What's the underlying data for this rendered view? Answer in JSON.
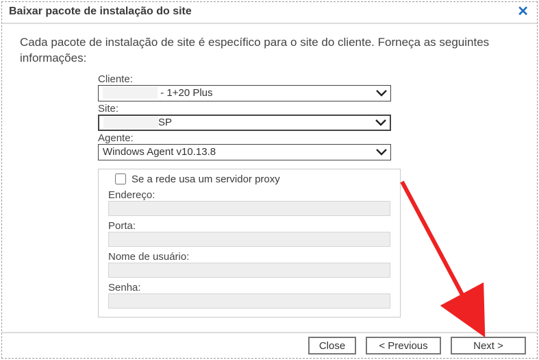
{
  "window": {
    "title": "Baixar pacote de instalação do site",
    "close_glyph": "✕"
  },
  "intro": "Cada pacote de instalação de site é específico para o site do cliente. Forneça as seguintes informações:",
  "form": {
    "client_label": "Cliente:",
    "client_value": " - 1+20 Plus",
    "site_label": "Site:",
    "site_value": "SP",
    "agent_label": "Agente:",
    "agent_value": "Windows Agent v10.13.8"
  },
  "proxy": {
    "checkbox_label": "Se a rede usa um servidor proxy",
    "checked": false,
    "address_label": "Endereço:",
    "address_value": "",
    "port_label": "Porta:",
    "port_value": "",
    "username_label": "Nome de usuário:",
    "username_value": "",
    "password_label": "Senha:",
    "password_value": ""
  },
  "footer": {
    "close": "Close",
    "previous": "< Previous",
    "next": "Next >"
  }
}
